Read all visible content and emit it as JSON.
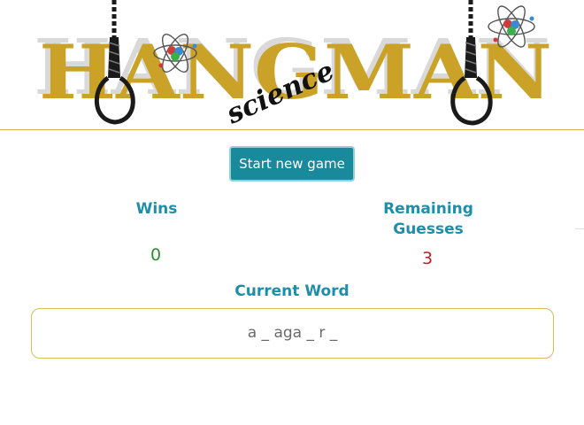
{
  "header": {
    "logo_word": "HANGMAN",
    "logo_subtitle": "science",
    "logo_color": "#c9a227",
    "icons": [
      "noose-icon",
      "atom-icon"
    ]
  },
  "controls": {
    "start_label": "Start new game",
    "button_color": "#188a9c"
  },
  "stats": {
    "wins_label": "Wins",
    "wins_value": "0",
    "remaining_label_line1": "Remaining",
    "remaining_label_line2": "Guesses",
    "remaining_value": "3",
    "accent_color": "#1f8ea8",
    "wins_color": "#2f8f2f",
    "remaining_color": "#c0202a"
  },
  "word": {
    "label": "Current Word",
    "display": "a _ aga _ r _"
  }
}
